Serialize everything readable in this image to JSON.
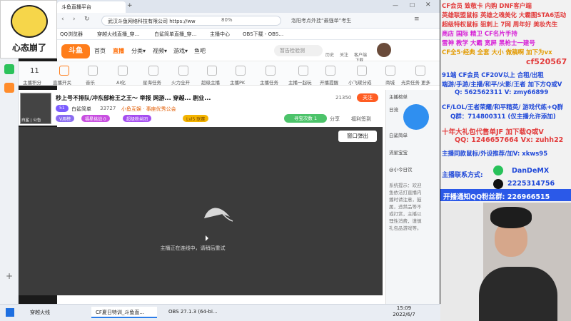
{
  "avatar": {
    "caption": "心态崩了"
  },
  "browser": {
    "tabs": [
      {
        "label": "斗鱼直播平台"
      }
    ],
    "url": "武汉斗鱼网络科技有限公司 https://ww",
    "zoom": "80%",
    "search_hint": "洛阳考点外挂“最强单”考生",
    "bookmarks": [
      "QQ浏览器",
      "穿越火线直播_穿…",
      "白鲨简单直播_穿…",
      "主播中心",
      "OBS下载 - OBS…"
    ]
  },
  "site": {
    "logo": "斗鱼",
    "nav": [
      "首页",
      "直播",
      "分类▾",
      "视频▾",
      "游戏▾",
      "鱼吧"
    ],
    "search_placeholder": "暂告检验测",
    "icons": [
      "历史",
      "关注",
      "客户端",
      "下载"
    ]
  },
  "categories": [
    {
      "label": "主播积分"
    },
    {
      "label": "直播开关"
    },
    {
      "label": "音乐"
    },
    {
      "label": "AI化"
    },
    {
      "label": "星海任务"
    },
    {
      "label": "火力全开"
    },
    {
      "label": "超级主播"
    },
    {
      "label": "主播PK"
    },
    {
      "label": "主播任务"
    },
    {
      "label": "主播一起玩"
    },
    {
      "label": "开播提醒"
    },
    {
      "label": "小飞碟分成"
    },
    {
      "label": "商城"
    },
    {
      "label": "光荣任务"
    },
    {
      "label": "更多"
    }
  ],
  "category_badge": "11",
  "stream": {
    "title": "秒上号不排队/冲东部枪王之王～ 举报 网游... 穿越... 剧业...",
    "streamer": "白鲨简单",
    "level": "51",
    "fans": "33727",
    "tag1": "小鱼互娱 · 事座优秀公会",
    "badges": [
      "V周榜",
      "福星挑战 0",
      "超级粉丝团",
      "Lvl5 联赛"
    ],
    "count": "21350",
    "follow_label": "关注",
    "task_label": "寻宝次数 1",
    "share": "分享",
    "gift": "福利签到",
    "caption": "白鲨 | 公告"
  },
  "player": {
    "popout": "窗口弹出",
    "offline": "主播正在连线中，请稍后重试"
  },
  "chat": {
    "items": [
      "主播榜单",
      "日流",
      "白鲨简单",
      "流星宝宝",
      "@小今日饮",
      "系统提示：欢迎",
      "鱼依法打直播内",
      "播时请注意，鼓",
      "属，违禁品等不",
      "或打赏，主播以",
      "理性消费，谨慎",
      "礼包品游戏等。"
    ]
  },
  "ads": [
    {
      "text": "CF会员 致敬卡 内购 DNF客户端",
      "color": "#e23b3b"
    },
    {
      "text": "英雄联盟鼠标 英雄之魂美化 大霸图STA6活动",
      "color": "#e23b3b"
    },
    {
      "text": "超级特权鼠标 狙刺上 7网 周年好 美妆先生",
      "color": "#e23b3b"
    },
    {
      "text": "商店 国际 精卫 CF名片手持",
      "color": "#d61bd6"
    },
    {
      "text": "雷神 教学 大霸 宽屏 黑枪士一建号",
      "color": "#d61bd6"
    },
    {
      "text": "CF全5·经典 全套 大小 做稿啊 加下为vx",
      "color": "#e29a00"
    },
    {
      "text": "cf520567",
      "color": "#e23b3b"
    },
    {
      "text": "91端 CF会员 CF20V以上 合租/出租",
      "color": "#1f48d8"
    },
    {
      "text": "端游/手游/主播/和平/火影/王者 加下方Q或V",
      "color": "#1f48d8"
    },
    {
      "text": "Q: 562562311 V: zmy66899",
      "color": "#1f48d8"
    },
    {
      "text": "CF/LOL/王者荣耀/和平精英/ 游戏代练+Q群",
      "color": "#1f48d8"
    },
    {
      "text": "Q群：714800311 (仅主播允许添加)",
      "color": "#1f48d8"
    },
    {
      "text": "十年大礼包代售单JF 加下载Q或V",
      "color": "#e23b3b"
    },
    {
      "text": "QQ: 1246657664 Vx: zuhh22",
      "color": "#e23b3b"
    },
    {
      "text": "主播同款鼠标/外设推荐/加V: xkws95",
      "color": "#1f48d8"
    },
    {
      "text": "主播联系方式:",
      "color": "#1f48d8"
    },
    {
      "text": "DanDeMX",
      "color": "#1f48d8"
    },
    {
      "text": "2225314756",
      "color": "#1f48d8"
    },
    {
      "text": "开播通知QQ粉丝群: 226966515",
      "color": "#ffffff"
    }
  ],
  "taskbar": {
    "items": [
      "穿越火线",
      "CF夏日特训_斗鱼直...",
      "OBS 27.1.3 (64-bi..."
    ],
    "time": "15:09",
    "date": "2022/6/7"
  }
}
